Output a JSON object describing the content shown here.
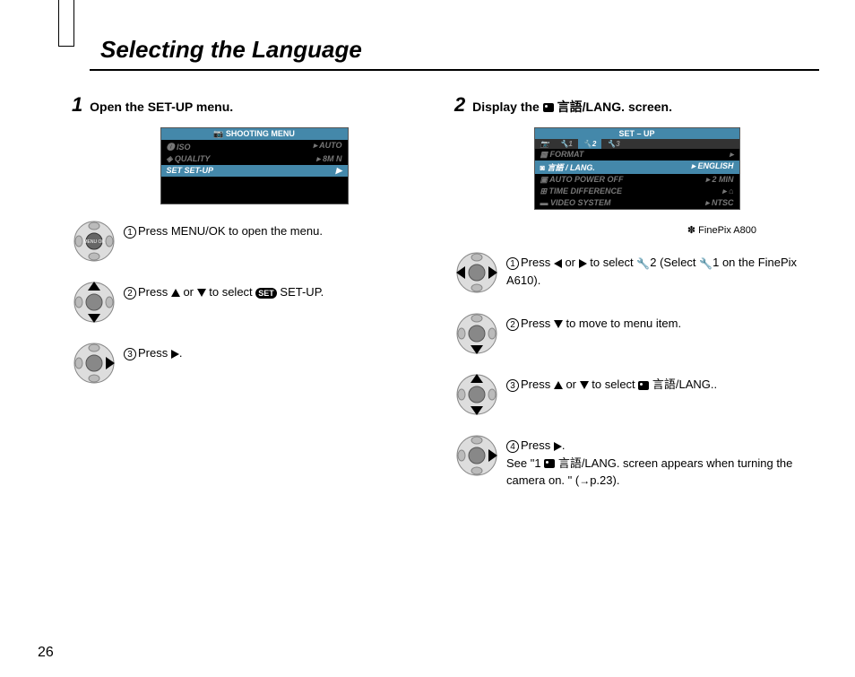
{
  "title": "Selecting the Language",
  "pageNumber": "26",
  "left": {
    "stepNum": "1",
    "heading": "Open the SET-UP menu.",
    "lcd": {
      "title": "SHOOTING MENU",
      "rows": [
        {
          "l": "ISO",
          "r": "AUTO"
        },
        {
          "l": "QUALITY",
          "r": "N"
        },
        {
          "l": "SET-UP",
          "r": "▶",
          "sel": true
        }
      ]
    },
    "steps": {
      "s1": "Press MENU/OK to open the menu.",
      "s2a": "Press ",
      "s2b": " or ",
      "s2c": " to select ",
      "s2d": " SET-UP.",
      "s3a": "Press ",
      "s3b": "."
    }
  },
  "right": {
    "stepNum": "2",
    "headA": "Display the ",
    "headLang": " 言語/LANG.",
    "headB": " screen.",
    "lcd": {
      "title": "SET – UP",
      "rows": [
        {
          "l": "FORMAT",
          "r": ""
        },
        {
          "l": "言語 / LANG.",
          "r": "ENGLISH",
          "sel": true
        },
        {
          "l": "AUTO POWER OFF",
          "r": "2  MIN"
        },
        {
          "l": "TIME DIFFERENCE",
          "r": "⌂"
        },
        {
          "l": "VIDEO SYSTEM",
          "r": "NTSC"
        }
      ]
    },
    "note": "✽ FinePix A800",
    "steps": {
      "s1a": "Press ",
      "s1b": " or ",
      "s1c": " to select ",
      "s1d": " (Select ",
      "s1e": " on the FinePix A610).",
      "w2": "2",
      "w1": "1",
      "s2a": "Press ",
      "s2b": " to move to menu item.",
      "s3a": "Press ",
      "s3b": " or ",
      "s3c": " to select ",
      "s3d": " 言語/LANG..",
      "s4a": "Press ",
      "s4b": ".",
      "s4c": "See \"1 ",
      "s4d": " 言語/LANG. screen appears when turning the camera on. \" (",
      "s4e": "p.23)."
    }
  }
}
